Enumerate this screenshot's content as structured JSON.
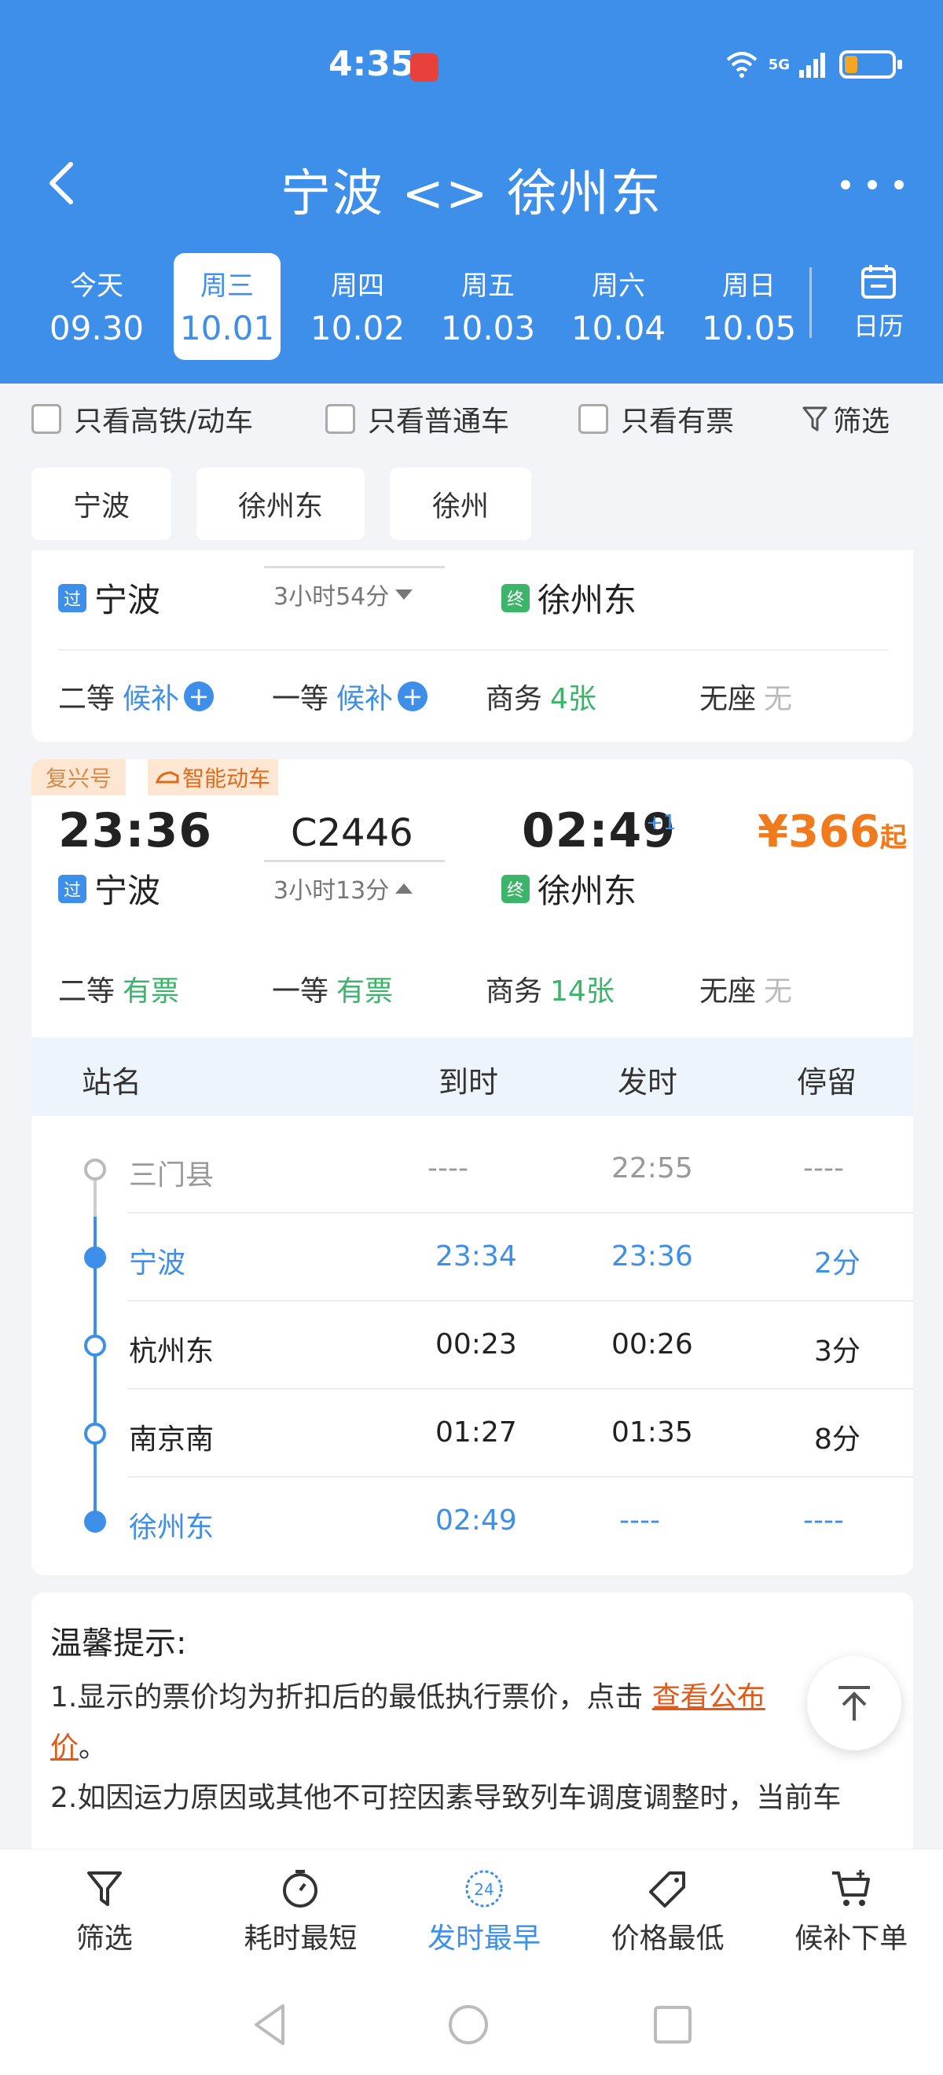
{
  "status_bar": {
    "time": "4:35",
    "network": "5G"
  },
  "header": {
    "title": "宁波 <> 徐州东"
  },
  "dates": [
    {
      "weekday": "今天",
      "date": "09.30"
    },
    {
      "weekday": "周三",
      "date": "10.01",
      "active": true
    },
    {
      "weekday": "周四",
      "date": "10.02"
    },
    {
      "weekday": "周五",
      "date": "10.03"
    },
    {
      "weekday": "周六",
      "date": "10.04"
    },
    {
      "weekday": "周日",
      "date": "10.05"
    }
  ],
  "calendar_label": "日历",
  "filters": {
    "high_speed": "只看高铁/动车",
    "normal": "只看普通车",
    "available": "只看有票",
    "filter": "筛选"
  },
  "station_chips": [
    "宁波",
    "徐州东",
    "徐州"
  ],
  "card1": {
    "from": "宁波",
    "to": "徐州东",
    "from_tag": "过",
    "to_tag": "终",
    "duration": "3小时54分",
    "seats": [
      {
        "label": "二等",
        "status": "候补",
        "plus": "+"
      },
      {
        "label": "一等",
        "status": "候补",
        "plus": "+"
      },
      {
        "label": "商务",
        "status": "4张"
      },
      {
        "label": "无座",
        "status": "无"
      }
    ]
  },
  "card2": {
    "badge1": "复兴号",
    "badge2": "智能动车",
    "depart_time": "23:36",
    "train_no": "C2446",
    "arrive_time": "02:49",
    "plus_day": "+1",
    "price": "¥366",
    "price_suffix": "起",
    "from": "宁波",
    "to": "徐州东",
    "from_tag": "过",
    "to_tag": "终",
    "duration": "3小时13分",
    "seats": [
      {
        "label": "二等",
        "status": "有票"
      },
      {
        "label": "一等",
        "status": "有票"
      },
      {
        "label": "商务",
        "status": "14张"
      },
      {
        "label": "无座",
        "status": "无"
      }
    ],
    "table_headers": {
      "station": "站名",
      "arrive": "到时",
      "depart": "发时",
      "stay": "停留"
    },
    "stops": [
      {
        "name": "三门县",
        "arrive": "----",
        "depart": "22:55",
        "stay": "----"
      },
      {
        "name": "宁波",
        "arrive": "23:34",
        "depart": "23:36",
        "stay": "2分"
      },
      {
        "name": "杭州东",
        "arrive": "00:23",
        "depart": "00:26",
        "stay": "3分"
      },
      {
        "name": "南京南",
        "arrive": "01:27",
        "depart": "01:35",
        "stay": "8分"
      },
      {
        "name": "徐州东",
        "arrive": "02:49",
        "depart": "----",
        "stay": "----"
      }
    ]
  },
  "tips": {
    "title": "温馨提示:",
    "line1_a": "1.显示的票价均为折扣后的最低执行票价，点击 ",
    "line1_link": "查看公布",
    "line1_link2": "价",
    "line1_b": "。",
    "line2": "2.如因运力原因或其他不可控因素导致列车调度调整时，当前车"
  },
  "tabbar": [
    {
      "label": "筛选",
      "icon": "funnel-icon"
    },
    {
      "label": "耗时最短",
      "icon": "timer-icon"
    },
    {
      "label": "发时最早",
      "icon": "clock-24-icon",
      "active": true
    },
    {
      "label": "价格最低",
      "icon": "price-tag-icon"
    },
    {
      "label": "候补下单",
      "icon": "cart-icon"
    }
  ],
  "colors": {
    "primary": "#3d8fe9",
    "green": "#3cb56a",
    "orange": "#f07a1e"
  }
}
